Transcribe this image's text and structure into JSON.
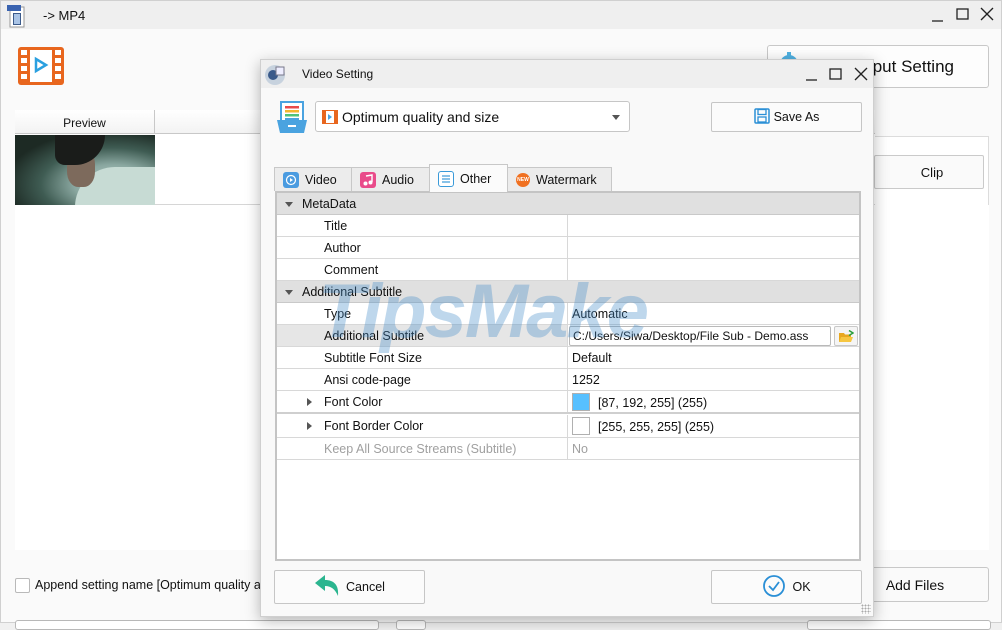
{
  "main_window": {
    "title": "-> MP4",
    "output_setting_label": "Output Setting",
    "file_list": {
      "columns": [
        "Preview",
        ""
      ]
    },
    "clip_label": "Clip",
    "append_setting_label": "Append setting name [Optimum quality and size]",
    "add_files_label": "Add Files"
  },
  "dialog": {
    "title": "Video Setting",
    "profile": {
      "selected": "Optimum quality and size"
    },
    "save_as_label": "Save As",
    "tabs": [
      {
        "label": "Video",
        "icon": "video-icon",
        "color": "#4a9be0",
        "active": false
      },
      {
        "label": "Audio",
        "icon": "music-icon",
        "color": "#e94b8a",
        "active": false
      },
      {
        "label": "Other",
        "icon": "list-icon",
        "color": "#3a9ad9",
        "active": true
      },
      {
        "label": "Watermark",
        "icon": "new-badge-icon",
        "color": "#f07020",
        "active": false
      }
    ],
    "properties": [
      {
        "type": "category",
        "label": "MetaData",
        "expanded": true
      },
      {
        "type": "item",
        "label": "Title",
        "value": ""
      },
      {
        "type": "item",
        "label": "Author",
        "value": ""
      },
      {
        "type": "item",
        "label": "Comment",
        "value": ""
      },
      {
        "type": "category",
        "label": "Additional Subtitle",
        "expanded": true
      },
      {
        "type": "item",
        "label": "Type",
        "value": "Automatic"
      },
      {
        "type": "path",
        "label": "Additional Subtitle",
        "value": "C:/Users/Siwa/Desktop/File Sub - Demo.ass",
        "selected": true
      },
      {
        "type": "item",
        "label": "Subtitle Font Size",
        "value": "Default"
      },
      {
        "type": "item",
        "label": "Ansi code-page",
        "value": "1252"
      },
      {
        "type": "color",
        "label": "Font Color",
        "value": "[87, 192, 255] (255)",
        "swatch": "#57c0ff"
      },
      {
        "type": "color",
        "label": "Font Border Color",
        "value": "[255, 255, 255] (255)",
        "swatch": "#ffffff"
      },
      {
        "type": "disabled",
        "label": "Keep All Source Streams (Subtitle)",
        "value": "No"
      }
    ],
    "cancel_label": "Cancel",
    "ok_label": "OK"
  },
  "watermark_text": "TipsMake",
  "colors": {
    "accent": "#3a9ad9",
    "logo_orange": "#e8661e",
    "cancel_green": "#2bb58f"
  }
}
